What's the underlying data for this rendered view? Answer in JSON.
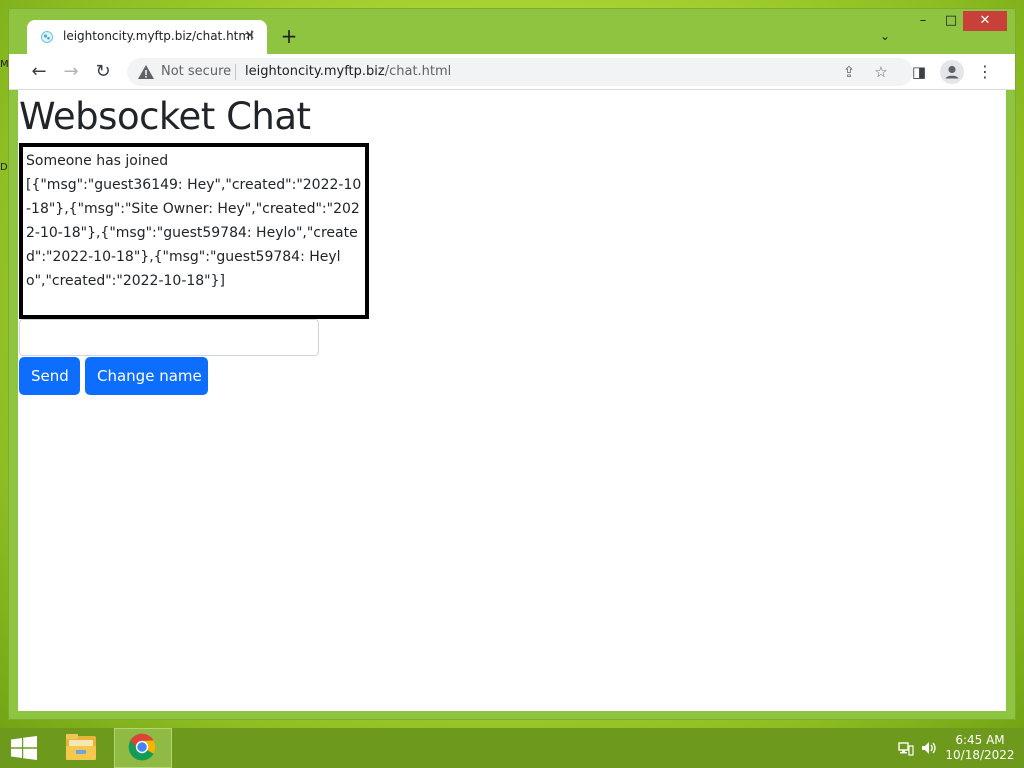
{
  "desktop": {
    "edge_labels": [
      "M",
      "D"
    ]
  },
  "browser": {
    "tab": {
      "title": "leightoncity.myftp.biz/chat.html",
      "close_icon": "×"
    },
    "new_tab_icon": "+",
    "tab_search_icon": "⌄",
    "window_controls": {
      "minimize": "–",
      "maximize": "□",
      "close": "✕"
    },
    "toolbar": {
      "back_icon": "←",
      "forward_icon": "→",
      "reload_icon": "↻",
      "security_label": "Not secure",
      "url_host": "leightoncity.myftp.biz",
      "url_path": "/chat.html",
      "share_icon": "⇪",
      "star_icon": "☆",
      "side_panel_icon": "◨",
      "menu_icon": "⋮"
    }
  },
  "page": {
    "title": "Websocket Chat",
    "chat_log": [
      "Someone has joined",
      "[{\"msg\":\"guest36149: Hey\",\"created\":\"2022-10-18\"},{\"msg\":\"Site Owner: Hey\",\"created\":\"2022-10-18\"},{\"msg\":\"guest59784: Heylo\",\"created\":\"2022-10-18\"},{\"msg\":\"guest59784: Heylo\",\"created\":\"2022-10-18\"}]"
    ],
    "message_input": {
      "value": "",
      "placeholder": ""
    },
    "send_label": "Send",
    "change_name_label": "Change name"
  },
  "taskbar": {
    "items": [
      "start",
      "file-explorer",
      "chrome"
    ],
    "active_item": "chrome",
    "clock": {
      "time": "6:45 AM",
      "date": "10/18/2022"
    }
  }
}
